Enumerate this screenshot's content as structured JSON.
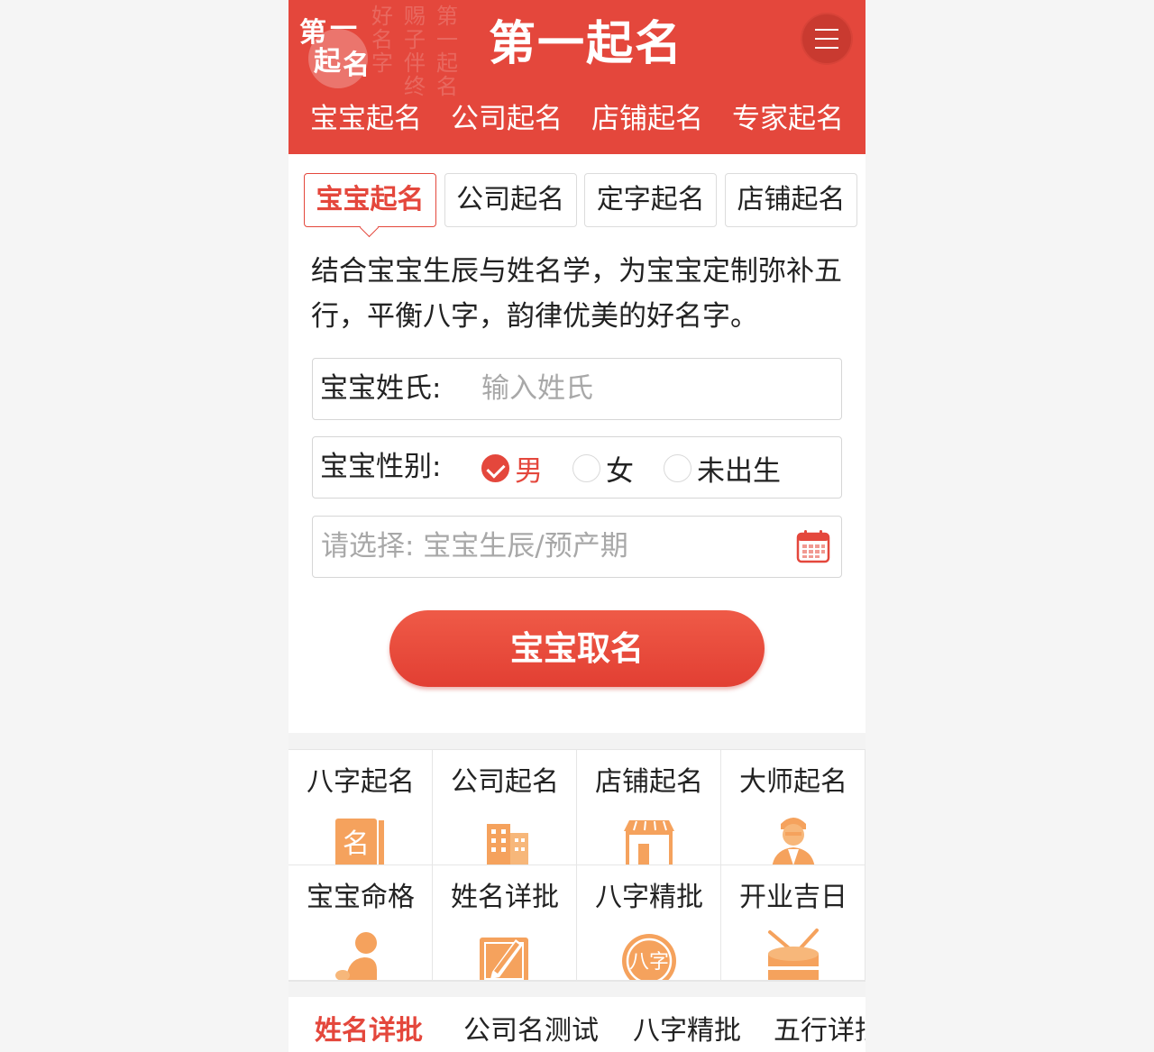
{
  "header": {
    "brand": "第一起名",
    "logo_chars": [
      "第",
      "一",
      "起",
      "名"
    ],
    "background_calligraphy": "好名字伴终生第一起名",
    "menu_icon": "hamburger-menu-icon",
    "nav": [
      "宝宝起名",
      "公司起名",
      "店铺起名",
      "专家起名"
    ]
  },
  "form": {
    "tabs": [
      "宝宝起名",
      "公司起名",
      "定字起名",
      "店铺起名"
    ],
    "active_tab": 0,
    "description": "结合宝宝生辰与姓名学，为宝宝定制弥补五行，平衡八字，韵律优美的好名字。",
    "surname_label": "宝宝姓氏:",
    "surname_placeholder": "输入姓氏",
    "gender_label": "宝宝性别:",
    "gender_options": [
      "男",
      "女",
      "未出生"
    ],
    "gender_selected": 0,
    "date_placeholder": "请选择: 宝宝生辰/预产期",
    "calendar_icon": "calendar-icon",
    "submit_label": "宝宝取名"
  },
  "services": [
    {
      "label": "八字起名",
      "icon": "name-book-icon"
    },
    {
      "label": "公司起名",
      "icon": "office-building-icon"
    },
    {
      "label": "店铺起名",
      "icon": "storefront-icon"
    },
    {
      "label": "大师起名",
      "icon": "master-avatar-icon"
    },
    {
      "label": "宝宝命格",
      "icon": "baby-icon"
    },
    {
      "label": "姓名详批",
      "icon": "notepad-pen-icon"
    },
    {
      "label": "八字精批",
      "icon": "bazi-seal-icon"
    },
    {
      "label": "开业吉日",
      "icon": "drum-icon"
    }
  ],
  "bottom_tabs": [
    "姓名详批",
    "公司名测试",
    "八字精批",
    "五行详批"
  ],
  "colors": {
    "brand_red": "#e4473c",
    "icon_orange": "#f5a25d",
    "text": "#222222",
    "placeholder": "#a8a8a8"
  }
}
